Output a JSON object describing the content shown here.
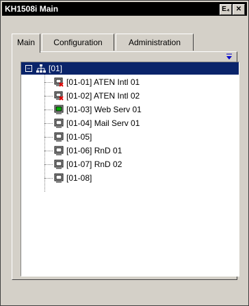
{
  "window": {
    "title": "KH1508i Main",
    "buttons": [
      {
        "name": "minimize-icon",
        "glyph": "E₄"
      },
      {
        "name": "close-icon",
        "glyph": "✕"
      }
    ]
  },
  "tabs": [
    {
      "label": "Main",
      "active": true
    },
    {
      "label": "Configuration",
      "active": false
    },
    {
      "label": "Administration",
      "active": false
    }
  ],
  "tree": {
    "root": {
      "label": "[01]",
      "expanded": true,
      "selected": true
    },
    "nodes": [
      {
        "label": "[01-01] ATEN Intl 01",
        "status": "error"
      },
      {
        "label": "[01-02] ATEN Intl 02",
        "status": "error"
      },
      {
        "label": "[01-03] Web Serv 01",
        "status": "online"
      },
      {
        "label": "[01-04] Mail Serv 01",
        "status": "normal"
      },
      {
        "label": "[01-05]",
        "status": "normal"
      },
      {
        "label": "[01-06] RnD 01",
        "status": "normal"
      },
      {
        "label": "[01-07] RnD 02",
        "status": "normal"
      },
      {
        "label": "[01-08]",
        "status": "normal"
      }
    ]
  },
  "colors": {
    "selection": "#0a246a",
    "online": "#00b000",
    "error": "#e00000"
  }
}
